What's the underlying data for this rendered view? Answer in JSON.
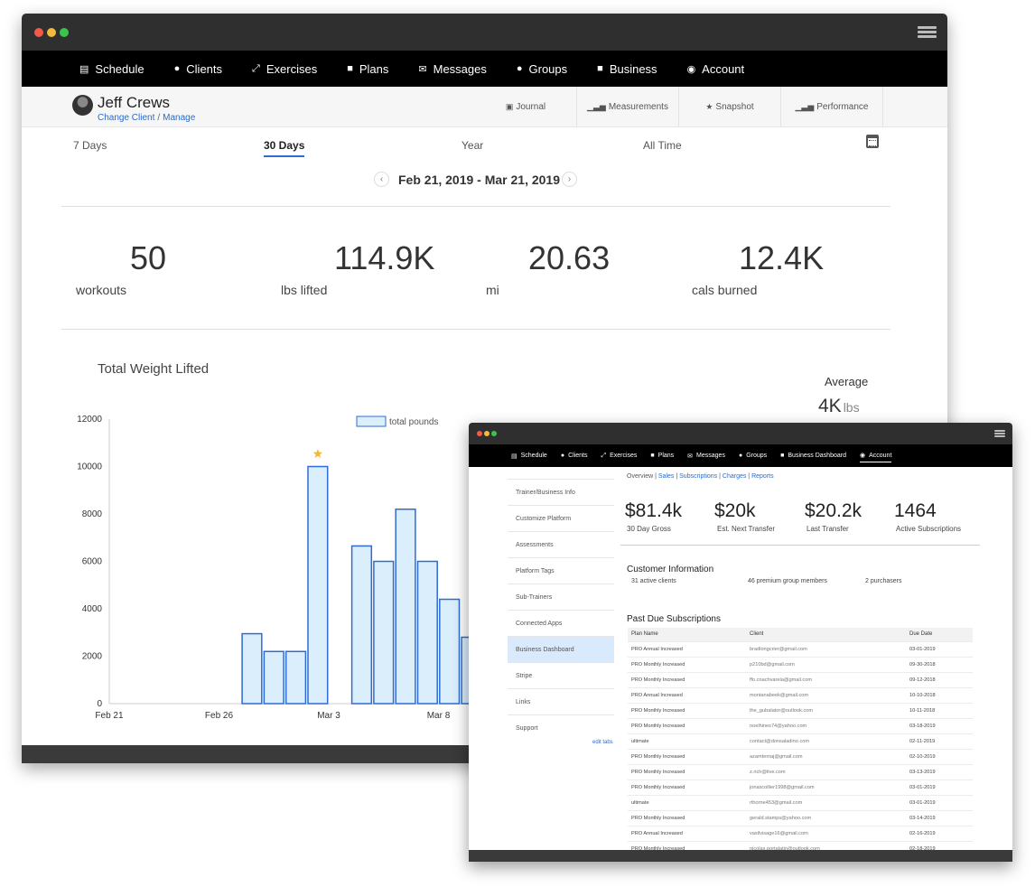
{
  "windowA": {
    "nav": [
      {
        "label": "Schedule",
        "icon": "book-icon",
        "glyph": "▤"
      },
      {
        "label": "Clients",
        "icon": "user-icon",
        "glyph": "●"
      },
      {
        "label": "Exercises",
        "icon": "compress-arrows-icon",
        "glyph": "⤢"
      },
      {
        "label": "Plans",
        "icon": "file-icon",
        "glyph": "■"
      },
      {
        "label": "Messages",
        "icon": "envelope-icon",
        "glyph": "✉"
      },
      {
        "label": "Groups",
        "icon": "users-icon",
        "glyph": "●"
      },
      {
        "label": "Business",
        "icon": "file-text-icon",
        "glyph": "■"
      },
      {
        "label": "Account",
        "icon": "user-circle-icon",
        "glyph": "◉"
      }
    ],
    "client": {
      "name": "Jeff Crews",
      "change_link": "Change Client",
      "separator": "/",
      "manage_link": "Manage"
    },
    "subtabs": [
      {
        "label": "Journal",
        "icon": "calendar-check-icon",
        "glyph": "▣"
      },
      {
        "label": "Measurements",
        "icon": "bar-chart-icon",
        "glyph": "▁▃▅"
      },
      {
        "label": "Snapshot",
        "icon": "star-icon",
        "glyph": "★"
      },
      {
        "label": "Performance",
        "icon": "bar-chart-icon",
        "glyph": "▁▃▅"
      }
    ],
    "periods": [
      "7 Days",
      "30 Days",
      "Year",
      "All Time"
    ],
    "active_period": "30 Days",
    "date_range": "Feb 21, 2019 - Mar 21, 2019",
    "prev_glyph": "‹",
    "next_glyph": "›",
    "stats": [
      {
        "value": "50",
        "label": "workouts"
      },
      {
        "value": "114.9K",
        "label": "lbs lifted"
      },
      {
        "value": "20.63",
        "label": "mi"
      },
      {
        "value": "12.4K",
        "label": "cals burned"
      }
    ],
    "average": {
      "label": "Average",
      "value": "4K",
      "unit": "lbs"
    }
  },
  "chart_data": {
    "type": "bar",
    "title": "Total Weight Lifted",
    "legend": [
      "total pounds"
    ],
    "legend_position": "top",
    "series": [
      {
        "name": "total pounds",
        "values": [
          0,
          0,
          0,
          0,
          0,
          0,
          2950,
          2200,
          2200,
          10000,
          0,
          6650,
          6000,
          8200,
          6000,
          4400,
          2800
        ]
      }
    ],
    "x_tick_labels": [
      "Feb 21",
      "Feb 26",
      "Mar 3",
      "Mar 8"
    ],
    "x_tick_positions": [
      0,
      5,
      10,
      15
    ],
    "ylim": [
      0,
      12000
    ],
    "y_ticks": [
      0,
      2000,
      4000,
      6000,
      8000,
      10000,
      12000
    ],
    "marked_max_index": 9,
    "bar_color": "#2f6bd3",
    "bar_fill": "#dbeefc",
    "grid": false
  },
  "windowB": {
    "nav": [
      {
        "label": "Schedule",
        "icon": "book-icon",
        "glyph": "▤"
      },
      {
        "label": "Clients",
        "icon": "user-icon",
        "glyph": "●"
      },
      {
        "label": "Exercises",
        "icon": "compress-arrows-icon",
        "glyph": "⤢"
      },
      {
        "label": "Plans",
        "icon": "file-icon",
        "glyph": "■"
      },
      {
        "label": "Messages",
        "icon": "envelope-icon",
        "glyph": "✉"
      },
      {
        "label": "Groups",
        "icon": "users-icon",
        "glyph": "●"
      },
      {
        "label": "Business Dashboard",
        "icon": "file-text-icon",
        "glyph": "■"
      },
      {
        "label": "Account",
        "icon": "user-circle-icon",
        "glyph": "◉"
      }
    ],
    "active_nav": "Account",
    "sidebar": [
      "Trainer/Business Info",
      "Customize Platform",
      "Assessments",
      "Platform Tags",
      "Sub-Trainers",
      "Connected Apps",
      "Business Dashboard",
      "Stripe",
      "Links",
      "Support"
    ],
    "active_sidebar": "Business Dashboard",
    "edit_tabs": "edit tabs",
    "tabs": [
      "Overview",
      "Sales",
      "Subscriptions",
      "Charges",
      "Reports"
    ],
    "stats": [
      {
        "value": "$81.4k",
        "label": "30 Day Gross"
      },
      {
        "value": "$20k",
        "label": "Est. Next Transfer"
      },
      {
        "value": "$20.2k",
        "label": "Last Transfer"
      },
      {
        "value": "1464",
        "label": "Active Subscriptions"
      }
    ],
    "customer_info": {
      "title": "Customer Information",
      "active_clients": "31 active clients",
      "premium_members": "46 premium group members",
      "purchasers": "2 purchasers"
    },
    "past_due": {
      "title": "Past Due Subscriptions",
      "columns": [
        "Plan Name",
        "Client",
        "Due Date"
      ],
      "rows": [
        [
          "PRO Annual Increased",
          "bradlongcrier@gmail.com",
          "03-01-2019"
        ],
        [
          "PRO Monthly Increased",
          "p210bd@gmail.com",
          "09-30-2018"
        ],
        [
          "PRO Monthly Increased",
          "ffo.coachvarela@gmail.com",
          "09-12-2018"
        ],
        [
          "PRO Annual Increased",
          "montanabeek@gmail.com",
          "10-10-2018"
        ],
        [
          "PRO Monthly Increased",
          "the_gubalator@outlook.com",
          "10-11-2018"
        ],
        [
          "PRO Monthly Increased",
          "noelhines74@yahoo.com",
          "03-18-2019"
        ],
        [
          "ultimate",
          "contact@donsaladino.com",
          "02-11-2019"
        ],
        [
          "PRO Monthly Increased",
          "azamtemaj@gmail.com",
          "02-10-2019"
        ],
        [
          "PRO Monthly Increased",
          "z.rich@live.com",
          "03-13-2019"
        ],
        [
          "PRO Monthly Increased",
          "jonascollier1998@gmail.com",
          "03-01-2019"
        ],
        [
          "ultimate",
          "rthorne453@gmail.com",
          "03-01-2019"
        ],
        [
          "PRO Monthly Increased",
          "gerald.stamps@yahoo.com",
          "03-14-2019"
        ],
        [
          "PRO Annual Increased",
          "vasilvisage16@gmail.com",
          "02-16-2019"
        ],
        [
          "PRO Monthly Increased",
          "nicolas.portalatin@outlook.com",
          "02-18-2019"
        ]
      ]
    }
  }
}
